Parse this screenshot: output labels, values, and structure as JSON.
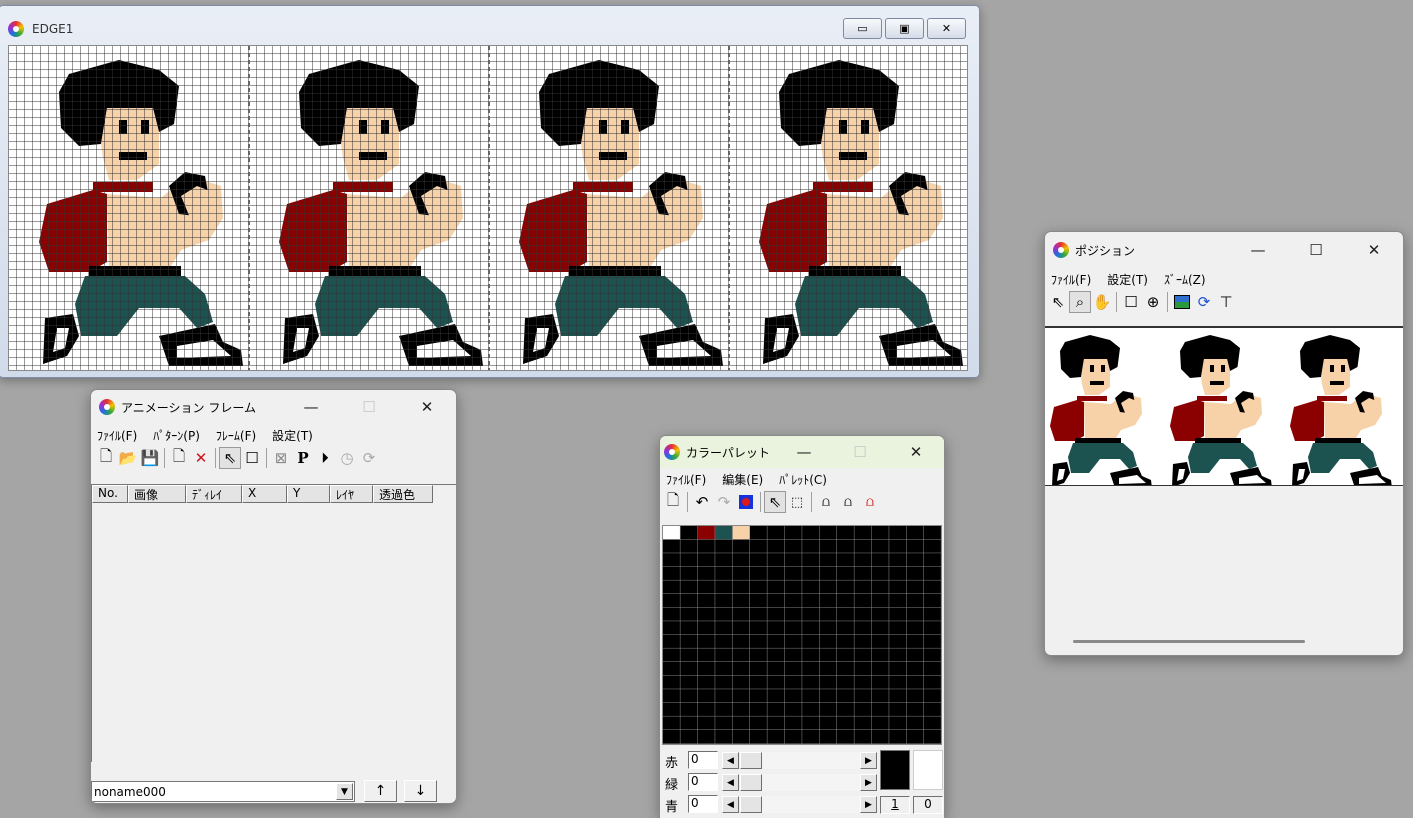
{
  "edge": {
    "title": "EDGE1",
    "min_label": "▭",
    "max_label": "▣",
    "close_label": "✕"
  },
  "anim": {
    "title": "アニメーション フレーム",
    "menus": [
      "ﾌｧｲﾙ(F)",
      "ﾊﾟﾀｰﾝ(P)",
      "ﾌﾚｰﾑ(F)",
      "設定(T)"
    ],
    "columns": [
      "No.",
      "画像",
      "ﾃﾞｨﾚｲ",
      "X",
      "Y",
      "ﾚｲﾔ",
      "透過色"
    ],
    "pattern_value": "noname000",
    "up_label": "↑",
    "down_label": "↓"
  },
  "palette": {
    "title": "カラーパレット",
    "menus": [
      "ﾌｧｲﾙ(F)",
      "編集(E)",
      "ﾊﾟﾚｯﾄ(C)"
    ],
    "colors": [
      "#ffffff",
      "#000000",
      "#8b0000",
      "#1c5350",
      "#f7d1a8"
    ],
    "red_label": "赤",
    "green_label": "緑",
    "blue_label": "青",
    "red_value": "0",
    "green_value": "0",
    "blue_value": "0",
    "index_a": "1",
    "index_b": "0"
  },
  "position": {
    "title": "ポジション",
    "menus": [
      "ﾌｧｲﾙ(F)",
      "設定(T)",
      "ｽﾞｰﾑ(Z)"
    ]
  }
}
